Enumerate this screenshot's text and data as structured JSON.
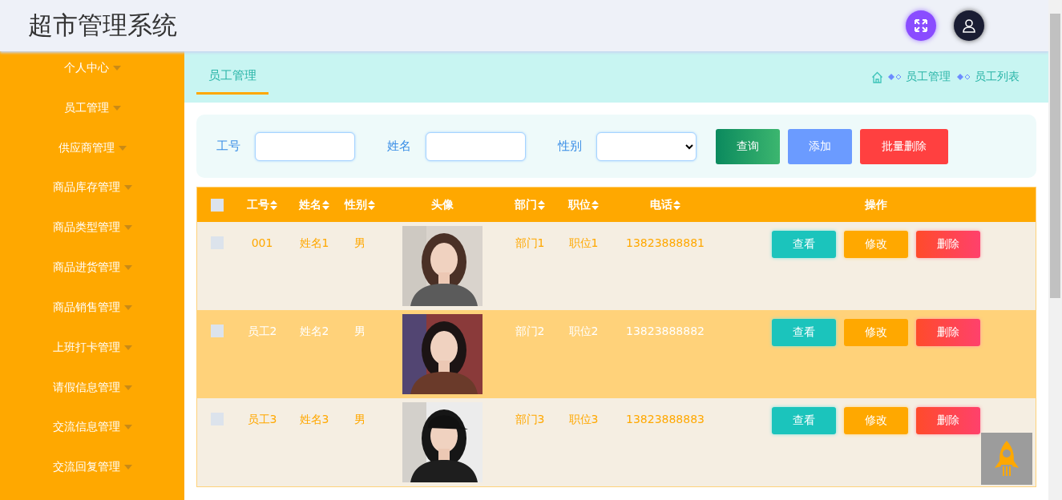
{
  "header": {
    "title": "超市管理系统"
  },
  "sidebar": {
    "items": [
      {
        "label": "个人中心",
        "expanded": false
      },
      {
        "label": "员工管理",
        "expanded": false
      },
      {
        "label": "供应商管理",
        "expanded": false
      },
      {
        "label": "商品库存管理",
        "expanded": false
      },
      {
        "label": "商品类型管理",
        "expanded": false
      },
      {
        "label": "商品进货管理",
        "expanded": false
      },
      {
        "label": "商品销售管理",
        "expanded": false
      },
      {
        "label": "上班打卡管理",
        "expanded": false
      },
      {
        "label": "请假信息管理",
        "expanded": false
      },
      {
        "label": "交流信息管理",
        "expanded": false
      },
      {
        "label": "交流回复管理",
        "expanded": false
      }
    ]
  },
  "tabs": [
    {
      "label": "员工管理",
      "selected": true
    }
  ],
  "breadcrumb": [
    "员工管理",
    "员工列表"
  ],
  "search": {
    "fields": [
      {
        "label": "工号",
        "kind": "text"
      },
      {
        "label": "姓名",
        "kind": "text"
      },
      {
        "label": "性别",
        "kind": "select"
      }
    ],
    "buttons": [
      {
        "label": "查询",
        "kind": "query"
      },
      {
        "label": "添加",
        "kind": "add"
      },
      {
        "label": "批量删除",
        "kind": "delete"
      }
    ]
  },
  "table": {
    "select_all": {
      "checked": false
    },
    "columns": [
      {
        "label": "工号",
        "sortable": true
      },
      {
        "label": "姓名",
        "sortable": true
      },
      {
        "label": "性别",
        "sortable": true
      },
      {
        "label": "头像",
        "sortable": false
      },
      {
        "label": "部门",
        "sortable": true
      },
      {
        "label": "职位",
        "sortable": true
      },
      {
        "label": "电话",
        "sortable": true
      },
      {
        "label": "操作",
        "sortable": false
      }
    ],
    "rows": [
      {
        "checked": false,
        "highlighted": false,
        "cells": [
          "001",
          "姓名1",
          "男",
          {
            "kind": "picture"
          },
          "部门1",
          "职位1",
          "13823888881"
        ],
        "actions": [
          {
            "label": "查看",
            "kind": "view"
          },
          {
            "label": "修改",
            "kind": "edit"
          },
          {
            "label": "删除",
            "kind": "delete"
          }
        ]
      },
      {
        "checked": false,
        "highlighted": true,
        "cells": [
          "员工2",
          "姓名2",
          "男",
          {
            "kind": "picture"
          },
          "部门2",
          "职位2",
          "13823888882"
        ],
        "actions": [
          {
            "label": "查看",
            "kind": "view"
          },
          {
            "label": "修改",
            "kind": "edit"
          },
          {
            "label": "删除",
            "kind": "delete"
          }
        ]
      },
      {
        "checked": false,
        "highlighted": false,
        "cells": [
          "员工3",
          "姓名3",
          "男",
          {
            "kind": "picture"
          },
          "部门3",
          "职位3",
          "13823888883"
        ],
        "actions": [
          {
            "label": "查看",
            "kind": "view"
          },
          {
            "label": "修改",
            "kind": "edit"
          },
          {
            "label": "删除",
            "kind": "delete"
          }
        ]
      }
    ]
  }
}
